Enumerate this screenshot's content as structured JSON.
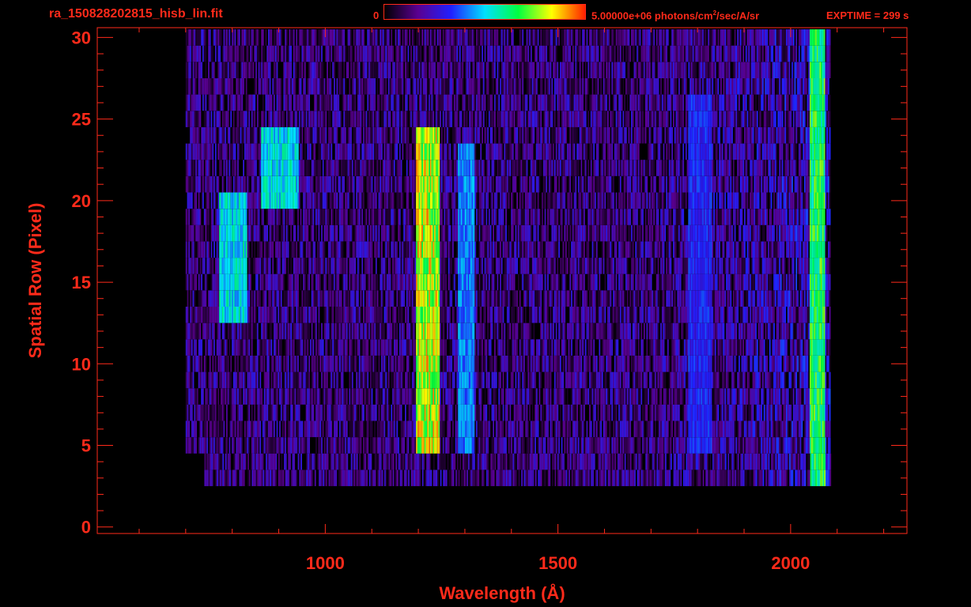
{
  "header": {
    "filename": "ra_150828202815_hisb_lin.fit",
    "colorbar_min": "0",
    "colorbar_max_value": "5.00000e+06",
    "colorbar_unit_pre": " photons/cm",
    "colorbar_unit_sup": "2",
    "colorbar_unit_post": "/sec/A/sr",
    "exptime": "EXPTIME = 299 s"
  },
  "colors": {
    "axis": "#ff2a1a",
    "background": "#000000",
    "colormap": [
      "#000000",
      "#5a0090",
      "#2020ff",
      "#00e0ff",
      "#00ff40",
      "#ffff00",
      "#ff2000"
    ]
  },
  "chart_data": {
    "type": "heatmap",
    "xlabel": "Wavelength (Å)",
    "ylabel": "Spatial Row (Pixel)",
    "xlim": [
      510,
      2250
    ],
    "ylim": [
      -0.4,
      30.6
    ],
    "xticks": [
      1000,
      1500,
      2000
    ],
    "yticks": [
      0,
      5,
      10,
      15,
      20,
      25,
      30
    ],
    "x_minor_step": 100,
    "y_minor_step": 1,
    "colorbar": {
      "min": 0,
      "max": 5000000,
      "colormap": "rainbow"
    },
    "emission_features": [
      {
        "x_range": [
          1195,
          1245
        ],
        "y_range": [
          5,
          24
        ],
        "level": 0.85
      },
      {
        "x_range": [
          1285,
          1320
        ],
        "y_range": [
          5,
          23
        ],
        "level": 0.45
      },
      {
        "x_range": [
          770,
          830
        ],
        "y_range": [
          13,
          20
        ],
        "level": 0.55
      },
      {
        "x_range": [
          860,
          940
        ],
        "y_range": [
          20,
          24
        ],
        "level": 0.55
      },
      {
        "x_range": [
          1780,
          1830
        ],
        "y_range": [
          5,
          26
        ],
        "level": 0.35
      },
      {
        "x_range": [
          2040,
          2072
        ],
        "y_range": [
          3,
          30
        ],
        "level": 0.7
      }
    ]
  }
}
